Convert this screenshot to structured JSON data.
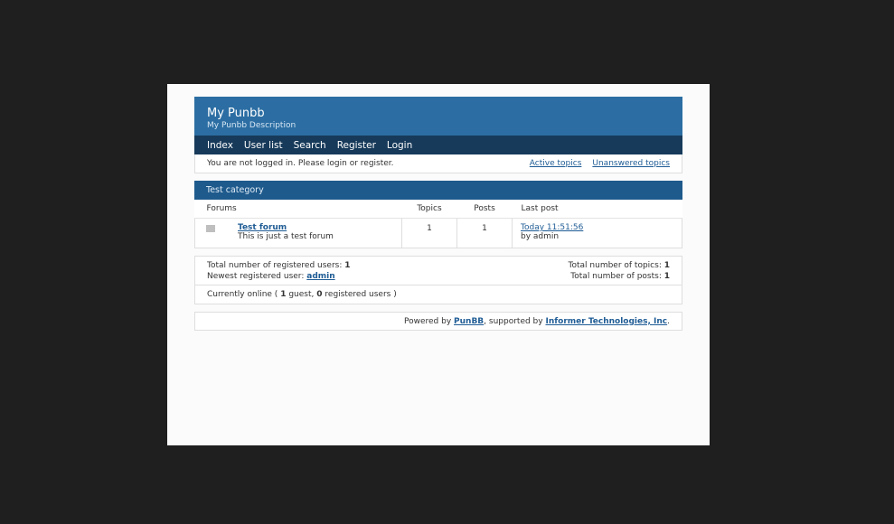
{
  "board": {
    "title": "My Punbb",
    "description": "My Punbb Description"
  },
  "nav": [
    "Index",
    "User list",
    "Search",
    "Register",
    "Login"
  ],
  "status": {
    "message": "You are not logged in. Please login or register.",
    "active_topics": "Active topics",
    "unanswered_topics": "Unanswered topics"
  },
  "category": {
    "title": "Test category",
    "columns": {
      "forums": "Forums",
      "topics": "Topics",
      "posts": "Posts",
      "last_post": "Last post"
    },
    "forums": [
      {
        "icon": "forum-icon",
        "title": "Test forum",
        "description": "This is just a test forum",
        "topics": "1",
        "posts": "1",
        "last_post_time": "Today 11:51:56",
        "last_post_by": "by admin"
      }
    ]
  },
  "stats": {
    "registered_label": "Total number of registered users:",
    "registered_value": "1",
    "newest_label": "Newest registered user:",
    "newest_value": "admin",
    "topics_label": "Total number of topics:",
    "topics_value": "1",
    "posts_label": "Total number of posts:",
    "posts_value": "1",
    "online_prefix": "Currently online (",
    "online_guests": "1",
    "online_guest_label": "guest,",
    "online_registered": "0",
    "online_suffix": "registered users )"
  },
  "footer": {
    "powered_by": "Powered by",
    "punbb": "PunBB",
    "supported_by": ", supported by",
    "informer": "Informer Technologies, Inc",
    "period": "."
  },
  "colors": {
    "header": "#2c6ea3",
    "nav": "#173a5a",
    "category": "#1e5a8c",
    "link": "#1f5c95"
  }
}
